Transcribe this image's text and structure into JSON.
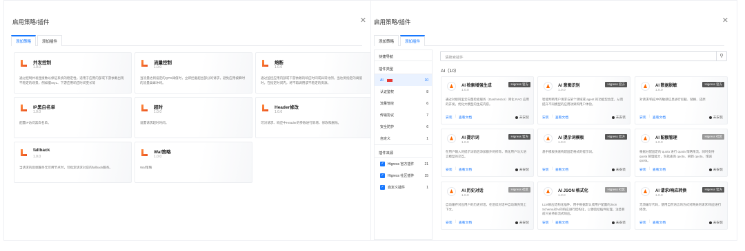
{
  "left": {
    "title": "启用策略/插件",
    "tabs": [
      "添加策略",
      "添加插件"
    ],
    "cards": [
      {
        "title": "并发控制",
        "version": "1.0.0",
        "desc": "通过控制并发连接数以保证系统的稳定性。适用于应用内部或下游依赖出现不稳定的场景，例如慢SQL、下游应用响应时间变长等"
      },
      {
        "title": "流量控制",
        "version": "1.0.0",
        "desc": "当流量达到设定的QPS阈值时，立即拦截超出部分的请求，避免应用被瞬时的流量高峰冲垮。"
      },
      {
        "title": "熔断",
        "version": "1.0.0",
        "desc": "通过监控应用内部或下游依赖的响应时间或异常比例，当达到指定的阈值时，在指定时间内，将不再调用该不稳定的资源。"
      },
      {
        "title": "IP黑白名单",
        "version": "1.0.0",
        "desc": "配置IP访问黑白名单。"
      },
      {
        "title": "超时",
        "version": "1.0.0",
        "desc": "设置请求超时时间。"
      },
      {
        "title": "Header修改",
        "version": "1.0.0",
        "desc": "可对请求、响应中Header的参数进行新增、修改和删除。"
      },
      {
        "title": "fallback",
        "version": "1.0.0",
        "desc": "当请求的后端服务无可用节点时，可指定请求对应的fallback服务。"
      },
      {
        "title": "Waf策略",
        "version": "1.0.0",
        "desc": "Waf策略"
      }
    ]
  },
  "right": {
    "title": "启用策略/插件",
    "tabs": [
      "添加策略",
      "添加插件"
    ],
    "nav": {
      "header": "快捷导航",
      "type_title": "插件类型",
      "types": [
        {
          "label": "AI",
          "count": "10"
        },
        {
          "label": "认证鉴权",
          "count": "8"
        },
        {
          "label": "流量管控",
          "count": "6"
        },
        {
          "label": "传输协议",
          "count": "7"
        },
        {
          "label": "安全防护",
          "count": "6"
        },
        {
          "label": "自定义",
          "count": "1"
        }
      ],
      "source_title": "插件来源",
      "sources": [
        {
          "label": "Higress 官方插件",
          "count": "21"
        },
        {
          "label": "Higress 社区插件",
          "count": "15"
        },
        {
          "label": "自定义插件",
          "count": "1"
        }
      ]
    },
    "search_placeholder": "请搜索插件",
    "section_title": "AI（10）",
    "install_label": "安装",
    "docs_label": "查看文档",
    "status_label": "未安装",
    "plugins": [
      {
        "title": "AI 检索增强生成",
        "version": "1.0.0",
        "badge": "Higress 官方",
        "desc": "通过对接阿里云向量检索服务（DashVector）简化 RAG 应用的开发，优化大模型的生成内容。"
      },
      {
        "title": "AI 意图识别",
        "version": "1.0.0",
        "badge": "Higress 官方",
        "desc": "智能判断用户请求与某个领域或 agent 的功能契合度，从而提升不同模型的应用效果和用户体验。"
      },
      {
        "title": "AI 数据脱敏",
        "version": "1.0.0",
        "badge": "Higress 官方",
        "desc": "对请求/响应中的敏感信息进行拦截、替换、还原"
      },
      {
        "title": "AI 提示词",
        "version": "1.0.0",
        "badge": "Higress 官方",
        "desc": "在用户输入的提示词前后添加额外的修饰，简化用户与大语言模型的交互。"
      },
      {
        "title": "AI 提示词模板",
        "version": "1.0.0",
        "badge": "Higress 官方",
        "desc": "基于模板快速构建固定格式的提示词。"
      },
      {
        "title": "AI 配额管理",
        "version": "1.0.0",
        "badge": "Higress 社区",
        "desc": "根据分配固定的 quota 进行 quota 策略限流，同时支持 quota 管理能力，包括查询 quota、刷新 quota、增减 quota。"
      },
      {
        "title": "AI 历史对话",
        "version": "1.0.0",
        "badge": "Higress 社区",
        "desc": "自动缓存对应用户的历史对话，在后续对话中自动填充到上下文。"
      },
      {
        "title": "AI JSON 格式化",
        "version": "1.0.0",
        "badge": "Higress 社区",
        "desc": "LLM响应结构化插件，用于根据默认或用户配置的Json Schema对AI的响应进行结构化，以便后续插件处理。注意目前只支持非流式响应。"
      },
      {
        "title": "AI 请求/响应转换",
        "version": "1.0.0",
        "badge": "Higress 官方",
        "desc": "无须编写代码，使用自然语言的方式对网关的请求/响应进行修改。"
      }
    ]
  }
}
